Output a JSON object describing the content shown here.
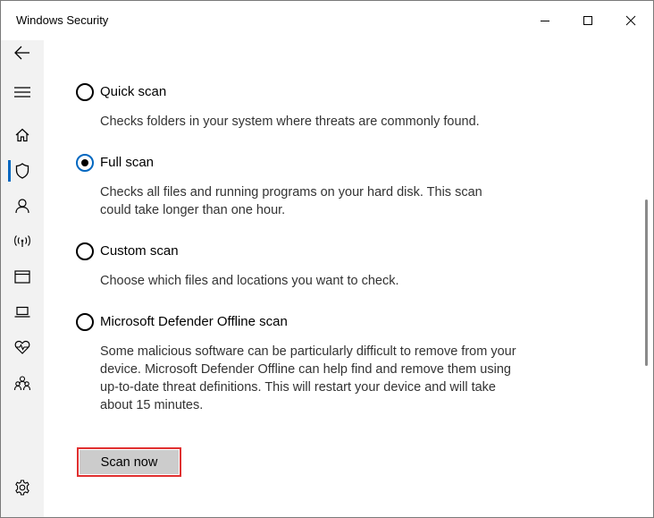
{
  "window": {
    "title": "Windows Security"
  },
  "sidebar": {
    "items": [
      {
        "name": "back-arrow-icon"
      },
      {
        "name": "hamburger-menu-icon"
      },
      {
        "name": "home-icon"
      },
      {
        "name": "shield-icon",
        "active": true
      },
      {
        "name": "person-icon"
      },
      {
        "name": "wifi-antenna-icon"
      },
      {
        "name": "browser-window-icon"
      },
      {
        "name": "laptop-icon"
      },
      {
        "name": "heart-pulse-icon"
      },
      {
        "name": "family-icon"
      },
      {
        "name": "gear-icon"
      }
    ]
  },
  "scan_options": [
    {
      "label": "Quick scan",
      "description": "Checks folders in your system where threats are commonly found.",
      "selected": false
    },
    {
      "label": "Full scan",
      "description": "Checks all files and running programs on your hard disk. This scan could take longer than one hour.",
      "selected": true
    },
    {
      "label": "Custom scan",
      "description": "Choose which files and locations you want to check.",
      "selected": false
    },
    {
      "label": "Microsoft Defender Offline scan",
      "description": "Some malicious software can be particularly difficult to remove from your device. Microsoft Defender Offline can help find and remove them using up-to-date threat definitions. This will restart your device and will take about 15 minutes.",
      "selected": false
    }
  ],
  "scan_button": {
    "label": "Scan now",
    "highlight_color": "#e03030"
  },
  "colors": {
    "accent": "#0067c0",
    "sidebar_bg": "#f2f2f2"
  }
}
